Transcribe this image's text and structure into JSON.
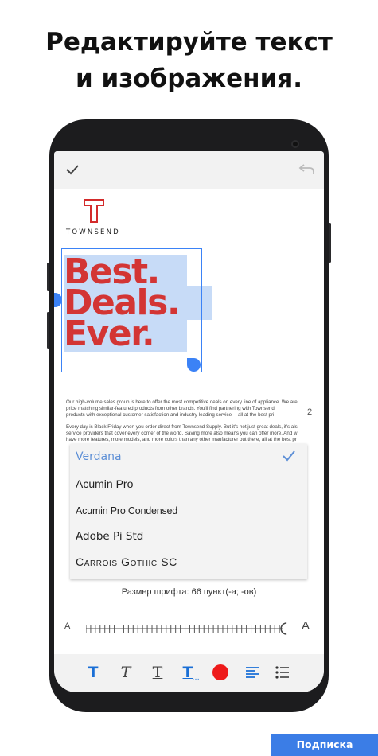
{
  "headline": {
    "line1": "Редактируйте текст",
    "line2": "и изображения."
  },
  "toolbar": {
    "confirm_icon": "check-icon",
    "undo_icon": "undo-icon"
  },
  "document": {
    "logo_text": "TOWNSEND",
    "headline_lines": [
      "Best.",
      "Deals.",
      "Ever."
    ],
    "headline_color": "#d33534",
    "body_paragraphs": [
      [
        "Our high-volume sales group is here to offer the most competitive deals on every line of appliance. We are",
        "price matching similar-featured products from other brands. You'll find partnering with Townsend",
        "products with exceptional customer satisfaction and industry-leading service —all at the best pri"
      ],
      [
        "Every day is Black Friday when you order direct from Townsend Supply. But it's not just great deals, it's als",
        "service providers that cover every corner of the world. Saving more also means you can offer more. And w",
        "have more features, more models, and more colors than any other maufacturer out there, all at the best pr"
      ]
    ],
    "page_number": "2"
  },
  "font_list": {
    "items": [
      {
        "label": "Verdana",
        "selected": true
      },
      {
        "label": "Acumin Pro",
        "selected": false
      },
      {
        "label": "Acumin Pro Condensed",
        "selected": false
      },
      {
        "label": "Adobe Pi Std",
        "selected": false
      },
      {
        "label": "Carrois Gothic SC",
        "selected": false
      }
    ]
  },
  "font_size": {
    "label": "Размер шрифта: 66 пункт(-а; -ов)",
    "small_a": "A",
    "large_a": "A",
    "value_fraction": 0.98
  },
  "format_toolbar": {
    "bold_glyph": "T",
    "italic_glyph": "T",
    "underline_glyph": "T",
    "more_glyph": "T",
    "color": "#ee1a1a",
    "accent": "#1a6fd6"
  },
  "subscribe_label": "Подписка"
}
